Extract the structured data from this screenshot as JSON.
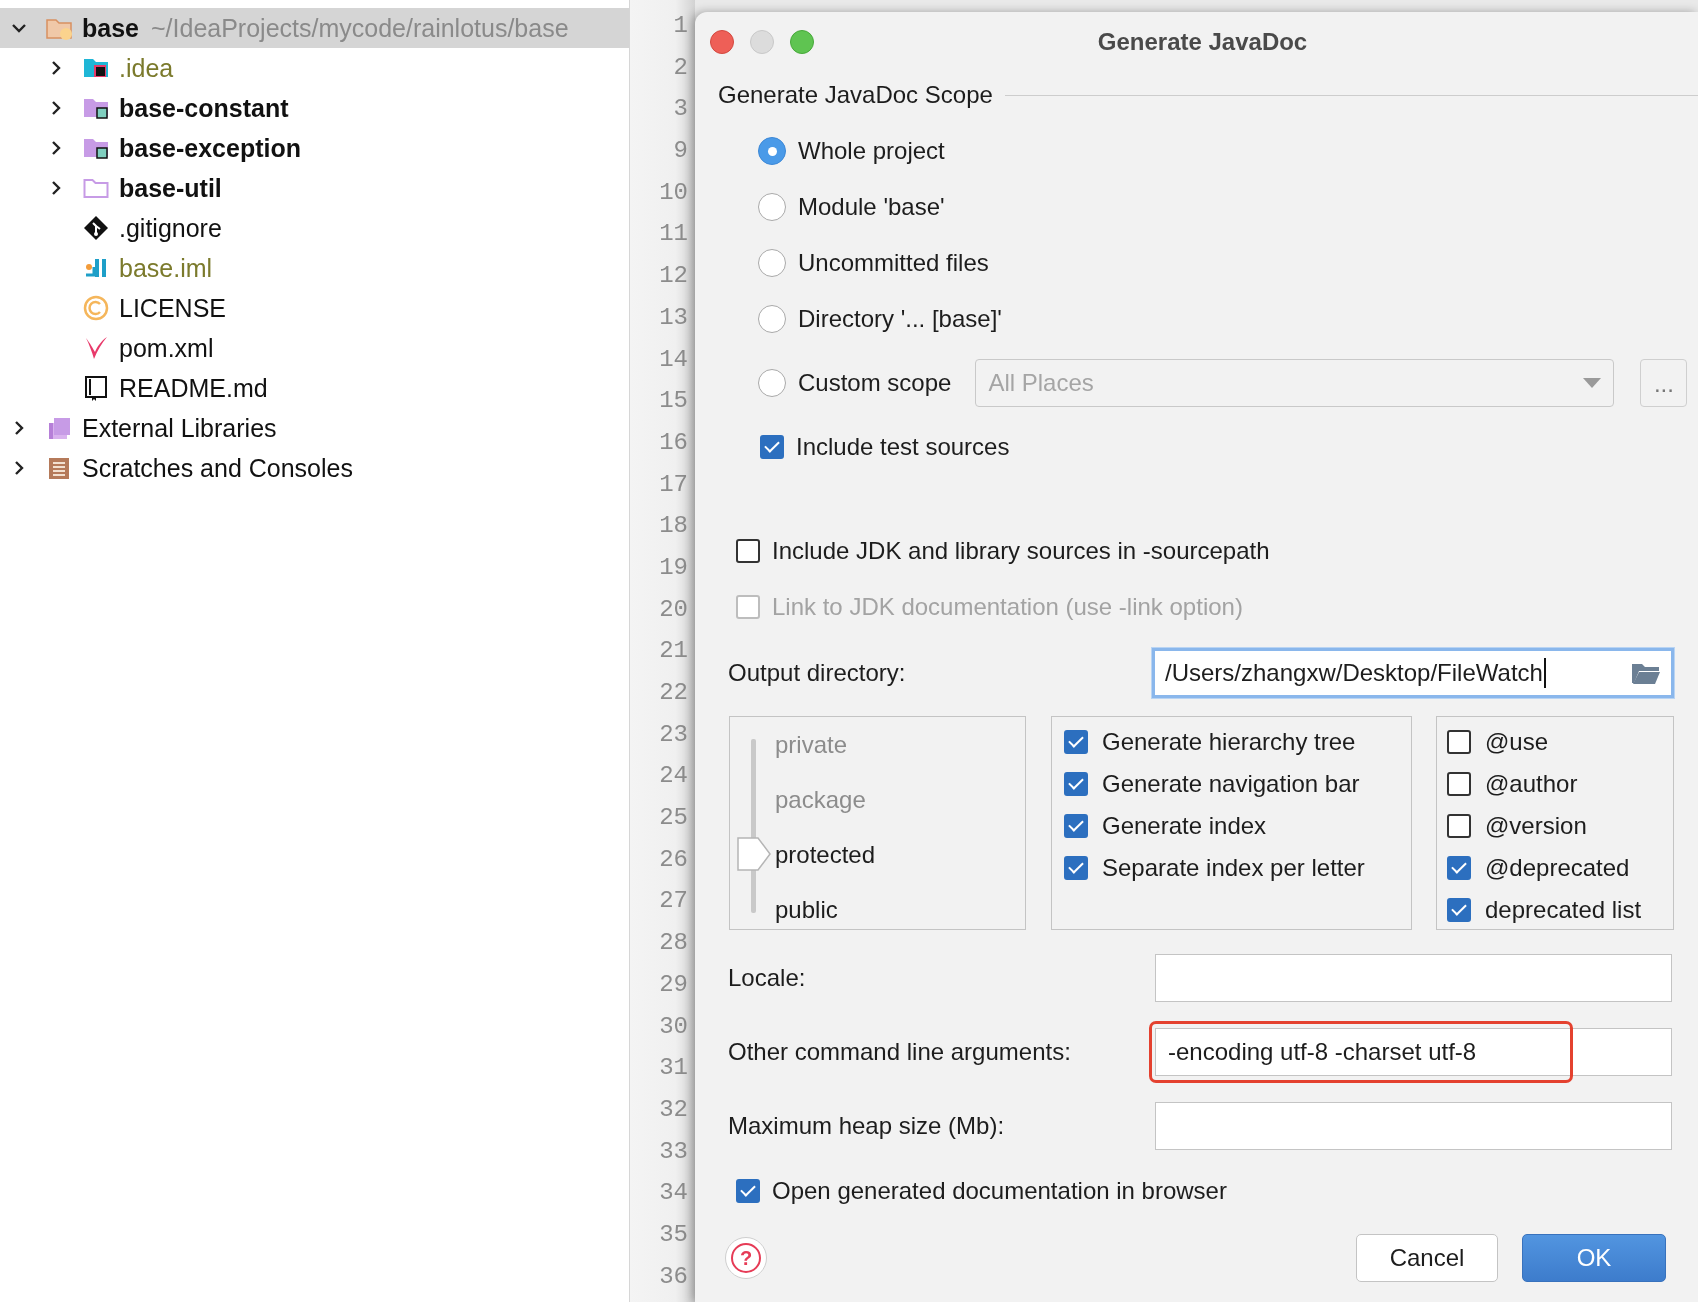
{
  "project_tree": {
    "items": [
      {
        "label": "base",
        "path": "~/IdeaProjects/mycode/rainlotus/base",
        "kind": "project",
        "bold": true,
        "ignored": false,
        "expandable": true,
        "expanded": true,
        "selected": true,
        "children": [
          {
            "label": ".idea",
            "kind": "config",
            "bold": false,
            "ignored": true,
            "expandable": true,
            "expanded": false,
            "selected": false
          },
          {
            "label": "base-constant",
            "kind": "module",
            "bold": true,
            "ignored": false,
            "expandable": true,
            "expanded": false,
            "selected": false
          },
          {
            "label": "base-exception",
            "kind": "module",
            "bold": true,
            "ignored": false,
            "expandable": true,
            "expanded": false,
            "selected": false
          },
          {
            "label": "base-util",
            "kind": "folder",
            "bold": true,
            "ignored": false,
            "expandable": true,
            "expanded": false,
            "selected": false
          },
          {
            "label": ".gitignore",
            "kind": "git",
            "bold": false,
            "ignored": false,
            "expandable": false,
            "selected": false
          },
          {
            "label": "base.iml",
            "kind": "iml",
            "bold": false,
            "ignored": true,
            "expandable": false,
            "selected": false
          },
          {
            "label": "LICENSE",
            "kind": "license",
            "bold": false,
            "ignored": false,
            "expandable": false,
            "selected": false
          },
          {
            "label": "pom.xml",
            "kind": "maven",
            "bold": false,
            "ignored": false,
            "expandable": false,
            "selected": false
          },
          {
            "label": "README.md",
            "kind": "readme",
            "bold": false,
            "ignored": false,
            "expandable": false,
            "selected": false
          }
        ]
      },
      {
        "label": "External Libraries",
        "kind": "libraries",
        "bold": false,
        "ignored": false,
        "expandable": true,
        "expanded": false,
        "selected": false
      },
      {
        "label": "Scratches and Consoles",
        "kind": "scratches",
        "bold": false,
        "ignored": false,
        "expandable": true,
        "expanded": false,
        "selected": false
      }
    ]
  },
  "editor": {
    "line_numbers": [
      "1",
      "2",
      "3",
      "9",
      "10",
      "11",
      "12",
      "13",
      "14",
      "15",
      "16",
      "17",
      "18",
      "19",
      "20",
      "21",
      "22",
      "23",
      "24",
      "25",
      "26",
      "27",
      "28",
      "29",
      "30",
      "31",
      "32",
      "33",
      "34",
      "35",
      "36"
    ]
  },
  "dialog": {
    "title": "Generate JavaDoc",
    "scope": {
      "heading": "Generate JavaDoc Scope",
      "options": [
        {
          "label": "Whole project",
          "selected": true
        },
        {
          "label": "Module 'base'",
          "selected": false
        },
        {
          "label": "Uncommitted files",
          "selected": false
        },
        {
          "label": "Directory '... [base]'",
          "selected": false
        },
        {
          "label": "Custom scope",
          "selected": false
        }
      ],
      "custom_scope_dropdown": {
        "value": "All Places",
        "disabled": true
      },
      "more_button": "...",
      "include_test_sources": {
        "label": "Include test sources",
        "checked": true,
        "disabled": false
      }
    },
    "options": [
      {
        "label": "Include JDK and library sources in -sourcepath",
        "checked": false,
        "disabled": false
      },
      {
        "label": "Link to JDK documentation (use -link option)",
        "checked": false,
        "disabled": true
      }
    ],
    "output_directory": {
      "label": "Output directory:",
      "value": "/Users/zhangxw/Desktop/FileWatch",
      "focused": true
    },
    "visibility_levels": [
      {
        "label": "private",
        "selected": false
      },
      {
        "label": "package",
        "selected": false
      },
      {
        "label": "protected",
        "selected": true
      },
      {
        "label": "public",
        "selected": false
      }
    ],
    "generate_options": [
      {
        "label": "Generate hierarchy tree",
        "checked": true
      },
      {
        "label": "Generate navigation bar",
        "checked": true
      },
      {
        "label": "Generate index",
        "checked": true
      },
      {
        "label": "Separate index per letter",
        "checked": true
      }
    ],
    "tag_options": [
      {
        "label": "@use",
        "checked": false
      },
      {
        "label": "@author",
        "checked": false
      },
      {
        "label": "@version",
        "checked": false
      },
      {
        "label": "@deprecated",
        "checked": true
      },
      {
        "label": "deprecated list",
        "checked": true
      }
    ],
    "fields": [
      {
        "label": "Locale:",
        "highlighted": false
      },
      {
        "label": "Other command line arguments:",
        "value": "-encoding utf-8 -charset utf-8",
        "highlighted": true
      },
      {
        "label": "Maximum heap size (Mb):",
        "highlighted": false
      }
    ],
    "open_in_browser": {
      "label": "Open generated documentation in browser",
      "checked": true,
      "disabled": false
    },
    "help_button": "?",
    "buttons": [
      {
        "label": "Cancel",
        "kind": "secondary"
      },
      {
        "label": "OK",
        "kind": "default"
      }
    ]
  }
}
